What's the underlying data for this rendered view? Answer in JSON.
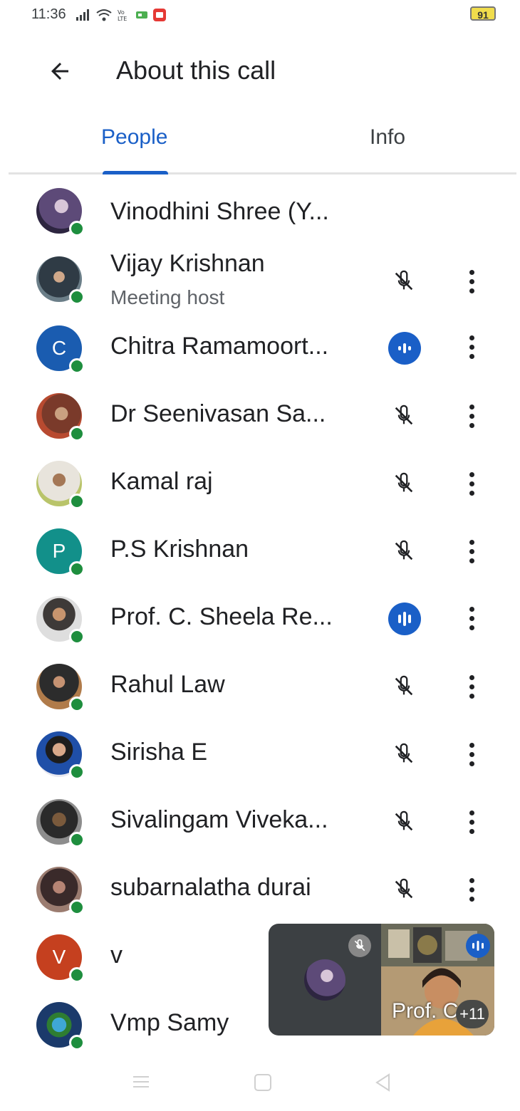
{
  "status_bar": {
    "time": "11:36",
    "battery": "91",
    "icons": [
      "signal-icon",
      "wifi-icon",
      "volte-icon",
      "notification-icon",
      "screen-record-icon"
    ]
  },
  "app_bar": {
    "title": "About this call",
    "back_icon": "arrow-back-icon"
  },
  "tabs": [
    {
      "label": "People",
      "active": true
    },
    {
      "label": "Info",
      "active": false
    }
  ],
  "participants": [
    {
      "name": "Vinodhini Shree (Y...",
      "subtitle": "",
      "mic": "none"
    },
    {
      "name": "Vijay Krishnan",
      "subtitle": "Meeting host",
      "mic": "muted"
    },
    {
      "name": "Chitra Ramamoort...",
      "subtitle": "",
      "mic": "speaking",
      "initial": "C"
    },
    {
      "name": "Dr Seenivasan Sa...",
      "subtitle": "",
      "mic": "muted"
    },
    {
      "name": "Kamal raj",
      "subtitle": "",
      "mic": "muted"
    },
    {
      "name": "P.S Krishnan",
      "subtitle": "",
      "mic": "muted",
      "initial": "P"
    },
    {
      "name": "Prof. C. Sheela Re...",
      "subtitle": "",
      "mic": "speaking"
    },
    {
      "name": "Rahul Law",
      "subtitle": "",
      "mic": "muted"
    },
    {
      "name": "Sirisha E",
      "subtitle": "",
      "mic": "muted"
    },
    {
      "name": "Sivalingam Viveka...",
      "subtitle": "",
      "mic": "muted"
    },
    {
      "name": "subarnalatha durai",
      "subtitle": "",
      "mic": "muted"
    },
    {
      "name": "v",
      "subtitle": "",
      "mic": "hidden",
      "initial": "V"
    },
    {
      "name": "Vmp Samy",
      "subtitle": "",
      "mic": "hidden"
    }
  ],
  "pip": {
    "name": "Prof. C",
    "count": "+11"
  },
  "colors": {
    "accent": "#1a5fc7",
    "online": "#1e8e3e",
    "text": "#202124",
    "secondary_text": "#5f6368"
  }
}
